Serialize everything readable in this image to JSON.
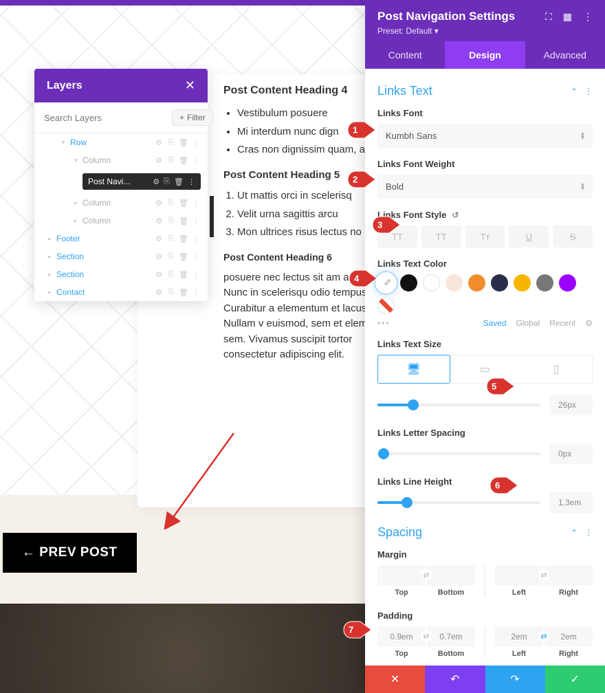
{
  "layers": {
    "title": "Layers",
    "search_placeholder": "Search Layers",
    "filter": "Filter",
    "items": [
      {
        "label": "Row",
        "type": "blue"
      },
      {
        "label": "Column",
        "type": "grey"
      },
      {
        "label": "Post Navi...",
        "type": "pill"
      },
      {
        "label": "Column",
        "type": "grey"
      },
      {
        "label": "Column",
        "type": "grey"
      },
      {
        "label": "Footer",
        "type": "blue"
      },
      {
        "label": "Section",
        "type": "blue"
      },
      {
        "label": "Section",
        "type": "blue"
      },
      {
        "label": "Contact",
        "type": "blue"
      }
    ]
  },
  "content": {
    "h4": "Post Content Heading 4",
    "ul": [
      "Vestibulum posuere",
      "Mi interdum nunc dign",
      "Cras non dignissim quam, a"
    ],
    "h5": "Post Content Heading 5",
    "ol": [
      "Ut mattis orci in scelerisq",
      "Velit urna sagittis arcu",
      "Mon ultrices risus lectus no"
    ],
    "h6": "Post Content Heading 6",
    "para": "posuere nec lectus sit am accumsan. Nunc in scelerisqu odio tempus et. Curabitur a elementum et lacus. Nullam v euismod, sem et elementum sem. Vivamus suscipit tortor consectetur adipiscing elit."
  },
  "prev_post": "←  PREV POST",
  "settings": {
    "title": "Post Navigation Settings",
    "preset": "Preset: Default ▾",
    "tabs": [
      "Content",
      "Design",
      "Advanced"
    ],
    "active_tab": 1,
    "links_text": {
      "title": "Links Text",
      "font_label": "Links Font",
      "font_value": "Kumbh Sans",
      "weight_label": "Links Font Weight",
      "weight_value": "Bold",
      "style_label": "Links Font Style",
      "style_btns": [
        "TT",
        "TT",
        "Tᴛ",
        "U",
        "S"
      ],
      "color_label": "Links Text Color",
      "colors": [
        "#ffffff",
        "#111111",
        "#ffffff",
        "#f7e6d9",
        "#f08c2e",
        "#2b2e4a",
        "#f7b500",
        "#777777",
        "#9b00ff",
        "hatched"
      ],
      "swatch_tabs": {
        "saved": "Saved",
        "global": "Global",
        "recent": "Recent"
      },
      "size_label": "Links Text Size",
      "size_value": "26px",
      "spacing_label": "Links Letter Spacing",
      "spacing_value": "0px",
      "lh_label": "Links Line Height",
      "lh_value": "1.3em"
    },
    "spacing": {
      "title": "Spacing",
      "margin_label": "Margin",
      "padding_label": "Padding",
      "sides": [
        "Top",
        "Bottom",
        "Left",
        "Right"
      ],
      "margin": [
        "",
        "",
        "",
        ""
      ],
      "padding": [
        "0.9em",
        "0.7em",
        "2em",
        "2em"
      ]
    }
  },
  "callouts": [
    "1",
    "2",
    "3",
    "4",
    "5",
    "6",
    "7"
  ]
}
